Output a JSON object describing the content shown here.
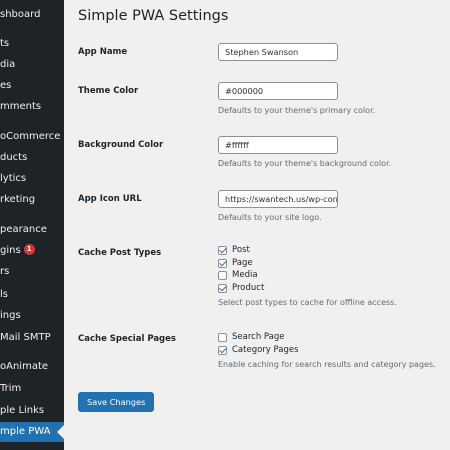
{
  "sidebar": {
    "items": [
      {
        "label": "shboard"
      },
      {
        "label": "ts"
      },
      {
        "label": "dia"
      },
      {
        "label": "es"
      },
      {
        "label": "mments"
      },
      {
        "label": "oCommerce"
      },
      {
        "label": "ducts"
      },
      {
        "label": "lytics"
      },
      {
        "label": "rketing"
      },
      {
        "label": "pearance"
      },
      {
        "label": "gins",
        "badge": "1"
      },
      {
        "label": "rs"
      },
      {
        "label": "ls"
      },
      {
        "label": "ings"
      },
      {
        "label": "Mail SMTP"
      },
      {
        "label": "oAnimate"
      },
      {
        "label": "Trim"
      },
      {
        "label": "ple Links"
      },
      {
        "label": "mple PWA",
        "active": true
      }
    ]
  },
  "main": {
    "title": "Simple PWA Settings",
    "fields": {
      "app_name": {
        "label": "App Name",
        "value": "Stephen Swanson"
      },
      "theme_color": {
        "label": "Theme Color",
        "value": "#000000",
        "desc": "Defaults to your theme's primary color."
      },
      "background_color": {
        "label": "Background Color",
        "value": "#ffffff",
        "desc": "Defaults to your theme's background color."
      },
      "app_icon_url": {
        "label": "App Icon URL",
        "value": "https://swantech.us/wp-content",
        "desc": "Defaults to your site logo."
      }
    },
    "cache_post_types": {
      "label": "Cache Post Types",
      "options": [
        {
          "label": "Post",
          "checked": true
        },
        {
          "label": "Page",
          "checked": true
        },
        {
          "label": "Media",
          "checked": false
        },
        {
          "label": "Product",
          "checked": true
        }
      ],
      "desc": "Select post types to cache for offline access."
    },
    "cache_special_pages": {
      "label": "Cache Special Pages",
      "options": [
        {
          "label": "Search Page",
          "checked": false
        },
        {
          "label": "Category Pages",
          "checked": true
        }
      ],
      "desc": "Enable caching for search results and category pages."
    },
    "save_button": "Save Changes"
  },
  "colors": {
    "sidebar_bg": "#1d2327",
    "accent": "#2271b1",
    "badge": "#d63638"
  }
}
